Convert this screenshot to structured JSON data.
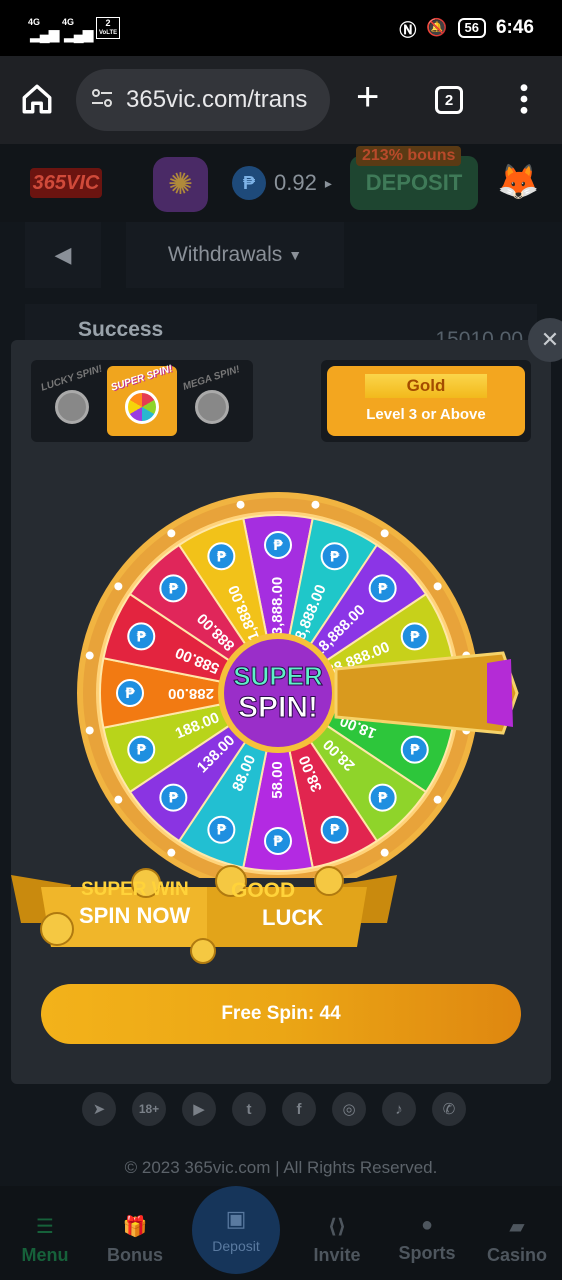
{
  "status": {
    "net1": "4G",
    "net2": "4G",
    "sim": "2",
    "volte": "VoLTE",
    "battery": "56",
    "time": "6:46"
  },
  "browser": {
    "url": "365vic.com/trans",
    "tab_count": "2",
    "home_icon": "home-icon",
    "plus_icon": "plus-icon",
    "menu_icon": "more-vert-icon"
  },
  "header": {
    "logo": "365VIC",
    "balance": "0.92",
    "currency_symbol": "₱",
    "deposit_label": "DEPOSIT",
    "bonus_tag": "213% bouns"
  },
  "page": {
    "filter_label": "Withdrawals",
    "row_status": "Success",
    "row_amount": "15010.00"
  },
  "modal": {
    "spin_types": [
      {
        "label": "LUCKY SPIN!",
        "selected": false
      },
      {
        "label": "SUPER SPIN!",
        "selected": true
      },
      {
        "label": "MEGA SPIN!",
        "selected": false
      }
    ],
    "tier_title": "Gold",
    "tier_subtitle": "Level 3 or Above",
    "wheel_center_line1": "SUPER",
    "wheel_center_line2": "SPIN!",
    "banner_left_line1": "SUPER WIN",
    "banner_left_line2": "SPIN NOW",
    "banner_right_line1": "GOOD",
    "banner_right_line2": "LUCK",
    "free_spin_label": "Free Spin: 44",
    "prizes": [
      "3,888.00",
      "8,888.00",
      "18,888.00",
      "38,888.00",
      "8.00",
      "18.00",
      "28.00",
      "38.00",
      "58.00",
      "88.00",
      "138.00",
      "188.00",
      "288.00",
      "588.00",
      "888.00",
      "1,888.00"
    ],
    "segment_colors": [
      "#a52ee0",
      "#1fc7c9",
      "#8b35e6",
      "#c7d11a",
      "#7fce1c",
      "#2dc63b",
      "#8fd42a",
      "#e1254f",
      "#b32ae2",
      "#22bfd2",
      "#8a34e2",
      "#b8d41a",
      "#f27a12",
      "#e3243f",
      "#e0265a",
      "#f2c219"
    ]
  },
  "footer": {
    "social_icons": [
      "telegram-icon",
      "18plus-icon",
      "youtube-icon",
      "twitter-icon",
      "facebook-icon",
      "instagram-icon",
      "tiktok-icon",
      "whatsapp-icon"
    ],
    "age_label": "18+",
    "copyright": "© 2023 365vic.com | All Rights Reserved."
  },
  "bottom_nav": {
    "menu": "Menu",
    "bonus": "Bonus",
    "deposit": "Deposit",
    "invite": "Invite",
    "sports": "Sports",
    "casino": "Casino"
  }
}
